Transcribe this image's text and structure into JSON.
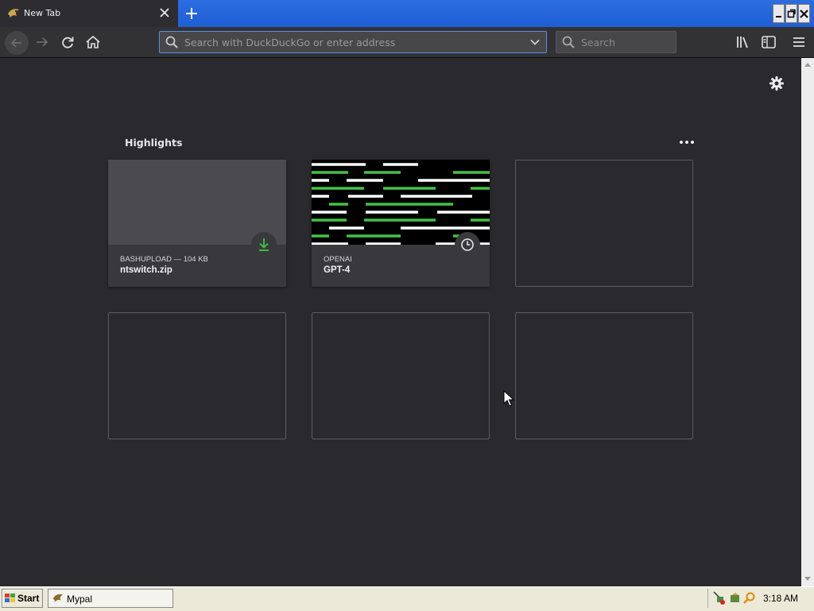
{
  "browser": {
    "tab": {
      "title": "New Tab"
    },
    "url_bar": {
      "placeholder": "Search with DuckDuckGo or enter address",
      "value": ""
    },
    "search_box": {
      "placeholder": "Search",
      "value": ""
    }
  },
  "newtab": {
    "highlights": {
      "title": "Highlights",
      "cards": [
        {
          "host": "BASHUPLOAD — 104 KB",
          "title": "ntswitch.zip",
          "badge": "download-icon"
        },
        {
          "host": "OPENAI",
          "title": "GPT-4",
          "badge": "history-clock-icon"
        }
      ]
    }
  },
  "taskbar": {
    "start_label": "Start",
    "tasks": [
      {
        "label": "Mypal"
      }
    ],
    "clock": "3:18 AM"
  },
  "colors": {
    "accent": "#2c6de0",
    "content_bg": "#2a2a2e",
    "card_bg": "#38383d",
    "download_green": "#3fb93f",
    "thumb_green": "#45c045"
  }
}
